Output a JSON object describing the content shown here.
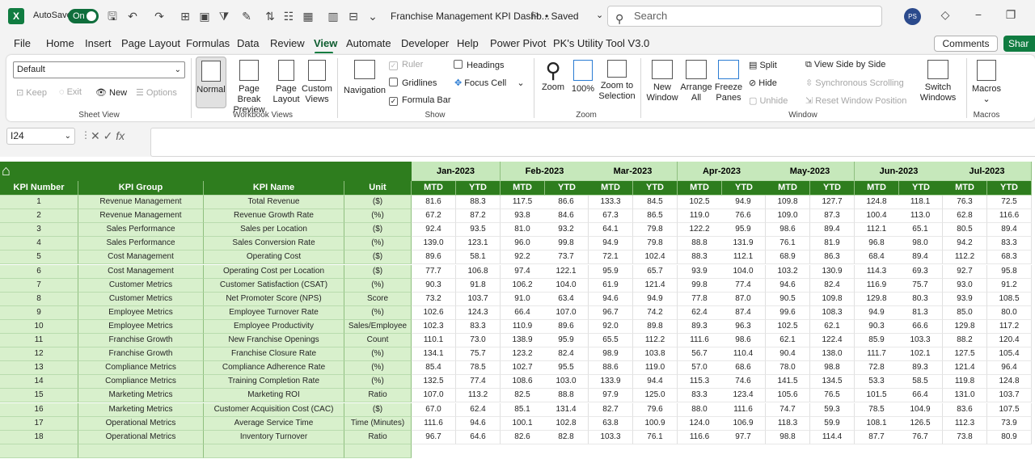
{
  "titlebar": {
    "app_icon": "X",
    "autosave_label": "AutoSave",
    "autosave_state": "On",
    "doc_title": "Franchise Management KPI Dashb...",
    "saved": "• Saved",
    "search_placeholder": "Search",
    "avatar": "PS"
  },
  "tabs": [
    "File",
    "Home",
    "Insert",
    "Page Layout",
    "Formulas",
    "Data",
    "Review",
    "View",
    "Automate",
    "Developer",
    "Help",
    "Power Pivot",
    "PK's Utility Tool V3.0"
  ],
  "active_tab": "View",
  "comments_label": "Comments",
  "share_label": "Shar",
  "ribbon": {
    "sheet_view": {
      "select": "Default",
      "keep": "Keep",
      "exit": "Exit",
      "new": "New",
      "options": "Options",
      "label": "Sheet View"
    },
    "workbook_views": {
      "normal": "Normal",
      "page_break": "Page Break",
      "page_break2": "Preview",
      "page_layout": "Page",
      "page_layout2": "Layout",
      "custom": "Custom",
      "custom2": "Views",
      "label": "Workbook Views"
    },
    "show": {
      "navigation": "Navigation",
      "ruler": "Ruler",
      "gridlines": "Gridlines",
      "formula_bar": "Formula Bar",
      "headings": "Headings",
      "focus_cell": "Focus Cell",
      "label": "Show"
    },
    "zoom": {
      "zoom": "Zoom",
      "pct": "100%",
      "sel1": "Zoom to",
      "sel2": "Selection",
      "label": "Zoom"
    },
    "window": {
      "new1": "New",
      "new2": "Window",
      "arr1": "Arrange",
      "arr2": "All",
      "frz1": "Freeze",
      "frz2": "Panes",
      "split": "Split",
      "hide": "Hide",
      "unhide": "Unhide",
      "side": "View Side by Side",
      "sync": "Synchronous Scrolling",
      "reset": "Reset Window Position",
      "sw1": "Switch",
      "sw2": "Windows",
      "label": "Window"
    },
    "macros": {
      "btn": "Macros",
      "label": "Macros"
    }
  },
  "formula_bar": {
    "cell_ref": "I24",
    "fx": "fx",
    "value": ""
  },
  "sheet": {
    "headers": [
      "KPI Number",
      "KPI Group",
      "KPI Name",
      "Unit"
    ],
    "months": [
      "Jan-2023",
      "Feb-2023",
      "Mar-2023",
      "Apr-2023",
      "May-2023",
      "Jun-2023",
      "Jul-2023"
    ],
    "sub": [
      "MTD",
      "YTD"
    ],
    "rows": [
      [
        "1",
        "Revenue Management",
        "Total Revenue",
        "($)",
        [
          81.6,
          88.3,
          117.5,
          86.6,
          133.3,
          84.5,
          102.5,
          94.9,
          109.8,
          127.7,
          124.8,
          118.1,
          76.3,
          72.5
        ]
      ],
      [
        "2",
        "Revenue Management",
        "Revenue Growth Rate",
        "(%)",
        [
          67.2,
          87.2,
          93.8,
          84.6,
          67.3,
          86.5,
          119.0,
          76.6,
          109.0,
          87.3,
          100.4,
          113.0,
          62.8,
          116.6
        ]
      ],
      [
        "3",
        "Sales Performance",
        "Sales per Location",
        "($)",
        [
          92.4,
          93.5,
          81.0,
          93.2,
          64.1,
          79.8,
          122.2,
          95.9,
          98.6,
          89.4,
          112.1,
          65.1,
          80.5,
          89.4
        ]
      ],
      [
        "4",
        "Sales Performance",
        "Sales Conversion Rate",
        "(%)",
        [
          139.0,
          123.1,
          96.0,
          99.8,
          94.9,
          79.8,
          88.8,
          131.9,
          76.1,
          81.9,
          96.8,
          98.0,
          94.2,
          83.3
        ]
      ],
      [
        "5",
        "Cost Management",
        "Operating Cost",
        "($)",
        [
          89.6,
          58.1,
          92.2,
          73.7,
          72.1,
          102.4,
          88.3,
          112.1,
          68.9,
          86.3,
          68.4,
          89.4,
          112.2,
          68.3
        ]
      ],
      [
        "6",
        "Cost Management",
        "Operating Cost per Location",
        "($)",
        [
          77.7,
          106.8,
          97.4,
          122.1,
          95.9,
          65.7,
          93.9,
          104.0,
          103.2,
          130.9,
          114.3,
          69.3,
          92.7,
          95.8
        ]
      ],
      [
        "7",
        "Customer Metrics",
        "Customer Satisfaction (CSAT)",
        "(%)",
        [
          90.3,
          91.8,
          106.2,
          104.0,
          61.9,
          121.4,
          99.8,
          77.4,
          94.6,
          82.4,
          116.9,
          75.7,
          93.0,
          91.2
        ]
      ],
      [
        "8",
        "Customer Metrics",
        "Net Promoter Score (NPS)",
        "Score",
        [
          73.2,
          103.7,
          91.0,
          63.4,
          94.6,
          94.9,
          77.8,
          87.0,
          90.5,
          109.8,
          129.8,
          80.3,
          93.9,
          108.5
        ]
      ],
      [
        "9",
        "Employee Metrics",
        "Employee Turnover Rate",
        "(%)",
        [
          102.6,
          124.3,
          66.4,
          107.0,
          96.7,
          74.2,
          62.4,
          87.4,
          99.6,
          108.3,
          94.9,
          81.3,
          85.0,
          80.0
        ]
      ],
      [
        "10",
        "Employee Metrics",
        "Employee Productivity",
        "Sales/Employee",
        [
          102.3,
          83.3,
          110.9,
          89.6,
          92.0,
          89.8,
          89.3,
          96.3,
          102.5,
          62.1,
          90.3,
          66.6,
          129.8,
          117.2
        ]
      ],
      [
        "11",
        "Franchise Growth",
        "New Franchise Openings",
        "Count",
        [
          110.1,
          73.0,
          138.9,
          95.9,
          65.5,
          112.2,
          111.6,
          98.6,
          62.1,
          122.4,
          85.9,
          103.3,
          88.2,
          120.4
        ]
      ],
      [
        "12",
        "Franchise Growth",
        "Franchise Closure Rate",
        "(%)",
        [
          134.1,
          75.7,
          123.2,
          82.4,
          98.9,
          103.8,
          56.7,
          110.4,
          90.4,
          138.0,
          111.7,
          102.1,
          127.5,
          105.4
        ]
      ],
      [
        "13",
        "Compliance Metrics",
        "Compliance Adherence Rate",
        "(%)",
        [
          85.4,
          78.5,
          102.7,
          95.5,
          88.6,
          119.0,
          57.0,
          68.6,
          78.0,
          98.8,
          72.8,
          89.3,
          121.4,
          96.4
        ]
      ],
      [
        "14",
        "Compliance Metrics",
        "Training Completion Rate",
        "(%)",
        [
          132.5,
          77.4,
          108.6,
          103.0,
          133.9,
          94.4,
          115.3,
          74.6,
          141.5,
          134.5,
          53.3,
          58.5,
          119.8,
          124.8
        ]
      ],
      [
        "15",
        "Marketing Metrics",
        "Marketing ROI",
        "Ratio",
        [
          107.0,
          113.2,
          82.5,
          88.8,
          97.9,
          125.0,
          83.3,
          123.4,
          105.6,
          76.5,
          101.5,
          66.4,
          131.0,
          103.7
        ]
      ],
      [
        "16",
        "Marketing Metrics",
        "Customer Acquisition Cost (CAC)",
        "($)",
        [
          67.0,
          62.4,
          85.1,
          131.4,
          82.7,
          79.6,
          88.0,
          111.6,
          74.7,
          59.3,
          78.5,
          104.9,
          83.6,
          107.5
        ]
      ],
      [
        "17",
        "Operational Metrics",
        "Average Service Time",
        "Time (Minutes)",
        [
          111.6,
          94.6,
          100.1,
          102.8,
          63.8,
          100.9,
          124.0,
          106.9,
          118.3,
          59.9,
          108.1,
          126.5,
          112.3,
          73.9
        ]
      ],
      [
        "18",
        "Operational Metrics",
        "Inventory Turnover",
        "Ratio",
        [
          96.7,
          64.6,
          82.6,
          82.8,
          103.3,
          76.1,
          116.6,
          97.7,
          98.8,
          114.4,
          87.7,
          76.7,
          73.8,
          80.9
        ]
      ]
    ]
  }
}
